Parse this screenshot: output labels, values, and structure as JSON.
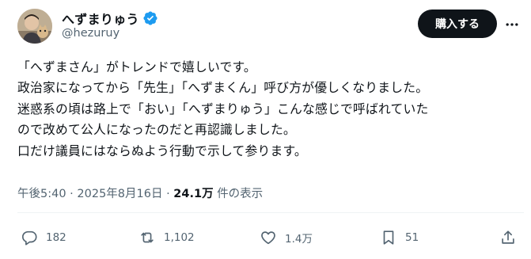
{
  "author": {
    "display_name": "へずまりゅう",
    "handle": "@hezuruy",
    "verified_icon": "verified-badge-icon"
  },
  "header": {
    "subscribe_label": "購入する",
    "more_icon": "more-options-icon"
  },
  "post": {
    "lines": [
      "「へずまさん」がトレンドで嬉しいです。",
      "政治家になってから「先生」「へずまくん」呼び方が優しくなりました。",
      "迷惑系の頃は路上で「おい」「へずまりゅう」こんな感じで呼ばれていた",
      "ので改めて公人になったのだと再認識しました。",
      "口だけ議員にはならぬよう行動で示して参ります。"
    ]
  },
  "meta": {
    "time": "午後5:40",
    "separator": "·",
    "date": "2025年8月16日",
    "views_count": "24.1万",
    "views_label": "件の表示"
  },
  "actions": {
    "replies": "182",
    "reposts": "1,102",
    "likes": "1.4万",
    "bookmarks": "51"
  },
  "colors": {
    "text": "#0f1419",
    "secondary": "#536471",
    "verified": "#1d9bf0",
    "button_bg": "#0f1419"
  }
}
